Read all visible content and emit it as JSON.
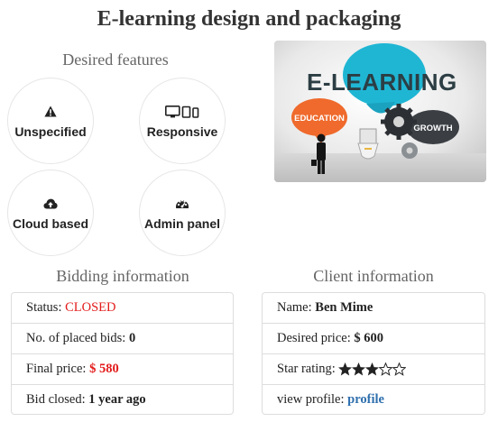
{
  "page": {
    "title": "E-learning design and packaging"
  },
  "features": {
    "heading": "Desired features",
    "items": [
      {
        "label": "Unspecified",
        "icon": "warning-icon"
      },
      {
        "label": "Responsive",
        "icon": "devices-icon"
      },
      {
        "label": "Cloud based",
        "icon": "cloud-upload-icon"
      },
      {
        "label": "Admin panel",
        "icon": "dashboard-icon"
      }
    ]
  },
  "hero": {
    "title": "E-LEARNING",
    "education": "EDUCATION",
    "growth": "GROWTH",
    "colors": {
      "cyan": "#1fb6d4",
      "orange": "#ef6a2c",
      "dark": "#2c3e44"
    }
  },
  "bidding": {
    "heading": "Bidding information",
    "status_label": "Status:",
    "status_value": "CLOSED",
    "bids_label": "No. of placed bids:",
    "bids_value": "0",
    "final_price_label": "Final price:",
    "final_price_value": "$ 580",
    "closed_label": "Bid closed:",
    "closed_value": "1 year ago"
  },
  "client": {
    "heading": "Client information",
    "name_label": "Name:",
    "name_value": "Ben Mime",
    "price_label": "Desired price:",
    "price_value": "$ 600",
    "rating_label": "Star rating:",
    "rating": 3,
    "rating_max": 5,
    "profile_label": "view profile:",
    "profile_link": "profile"
  },
  "colors": {
    "accent_red": "#e31b1b",
    "link_blue": "#2f6fad"
  }
}
